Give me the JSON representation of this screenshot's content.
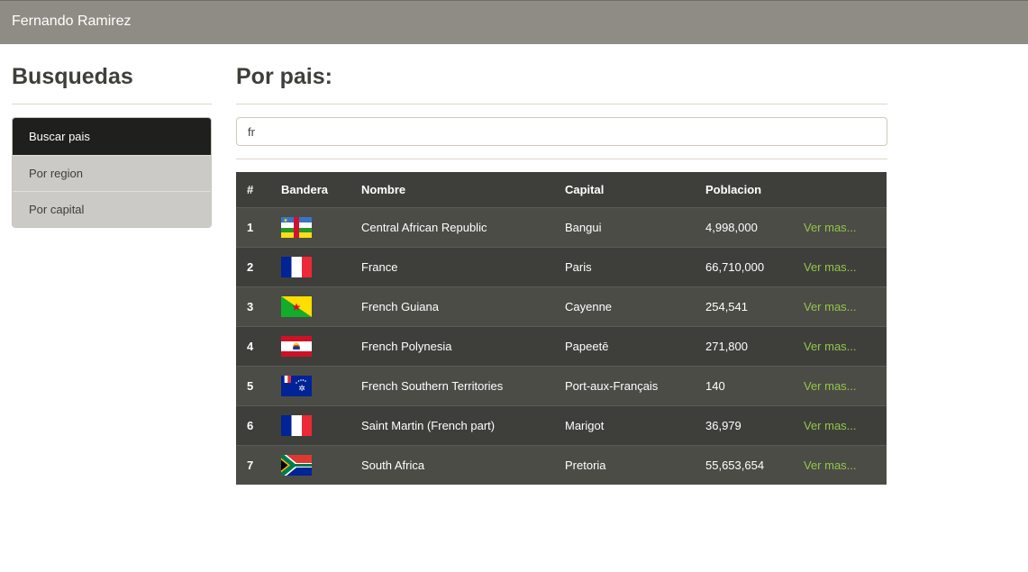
{
  "navbar": {
    "brand": "Fernando Ramirez"
  },
  "sidebar": {
    "title": "Busquedas",
    "items": [
      {
        "label": "Buscar pais",
        "active": true
      },
      {
        "label": "Por region",
        "active": false
      },
      {
        "label": "Por capital",
        "active": false
      }
    ]
  },
  "main": {
    "title": "Por pais:",
    "search": {
      "value": "fr",
      "placeholder": ""
    }
  },
  "table": {
    "headers": [
      "#",
      "Bandera",
      "Nombre",
      "Capital",
      "Poblacion",
      ""
    ],
    "link_label": "Ver mas...",
    "rows": [
      {
        "num": "1",
        "flag": "central-african-republic-flag",
        "name": "Central African Republic",
        "capital": "Bangui",
        "population": "4,998,000"
      },
      {
        "num": "2",
        "flag": "france-flag",
        "name": "France",
        "capital": "Paris",
        "population": "66,710,000"
      },
      {
        "num": "3",
        "flag": "french-guiana-flag",
        "name": "French Guiana",
        "capital": "Cayenne",
        "population": "254,541"
      },
      {
        "num": "4",
        "flag": "french-polynesia-flag",
        "name": "French Polynesia",
        "capital": "Papeetē",
        "population": "271,800"
      },
      {
        "num": "5",
        "flag": "french-southern-territories-flag",
        "name": "French Southern Territories",
        "capital": "Port-aux-Français",
        "population": "140"
      },
      {
        "num": "6",
        "flag": "saint-martin-flag",
        "name": "Saint Martin (French part)",
        "capital": "Marigot",
        "population": "36,979"
      },
      {
        "num": "7",
        "flag": "south-africa-flag",
        "name": "South Africa",
        "capital": "Pretoria",
        "population": "55,653,654"
      }
    ]
  },
  "colors": {
    "navbar": "#8e8c84",
    "active_item": "#1f1f1d",
    "table_dark": "#3e3f3a",
    "table_light": "#4b4c46",
    "link": "#93c54b"
  }
}
